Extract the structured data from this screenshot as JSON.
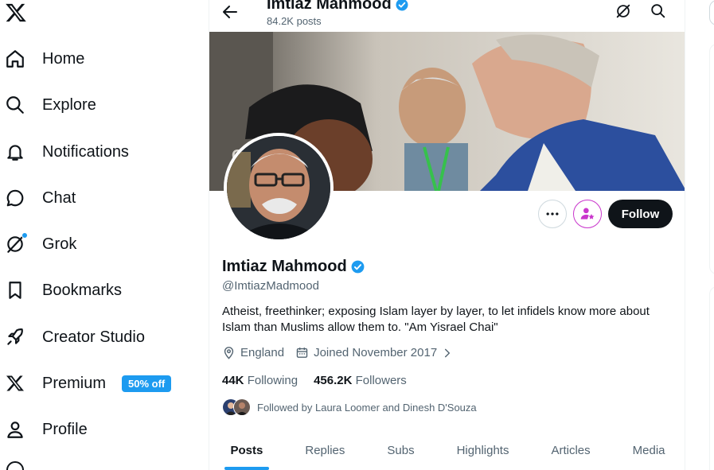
{
  "colors": {
    "accent": "#1d9bf0",
    "text": "#0f1419",
    "muted": "#536471",
    "subscribe": "#c936cc"
  },
  "nav": {
    "logo": "x-logo-icon",
    "items": [
      {
        "label": "Home",
        "icon": "home-icon"
      },
      {
        "label": "Explore",
        "icon": "search-icon"
      },
      {
        "label": "Notifications",
        "icon": "bell-icon"
      },
      {
        "label": "Chat",
        "icon": "chat-bubble-icon"
      },
      {
        "label": "Grok",
        "icon": "grok-icon"
      },
      {
        "label": "Bookmarks",
        "icon": "bookmark-icon"
      },
      {
        "label": "Creator Studio",
        "icon": "rocket-icon"
      },
      {
        "label": "Premium",
        "icon": "x-logo-icon",
        "badge": "50% off"
      },
      {
        "label": "Profile",
        "icon": "person-icon"
      }
    ]
  },
  "header": {
    "name": "Imtiaz Mahmood",
    "posts_count": "84.2K posts"
  },
  "profile": {
    "name": "Imtiaz Mahmood",
    "handle": "@ImtiazMadmood",
    "bio": "Atheist, freethinker; exposing Islam layer by layer, to let infidels know more about Islam than Muslims allow them to. \"Am Yisrael Chai\"",
    "location": "England",
    "joined": "Joined November 2017",
    "following_count": "44K",
    "following_label": "Following",
    "followers_count": "456.2K",
    "followers_label": "Followers",
    "followed_by": "Followed by Laura Loomer and Dinesh D'Souza",
    "follow_button": "Follow"
  },
  "tabs": [
    "Posts",
    "Replies",
    "Subs",
    "Highlights",
    "Articles",
    "Media"
  ],
  "active_tab": "Posts"
}
